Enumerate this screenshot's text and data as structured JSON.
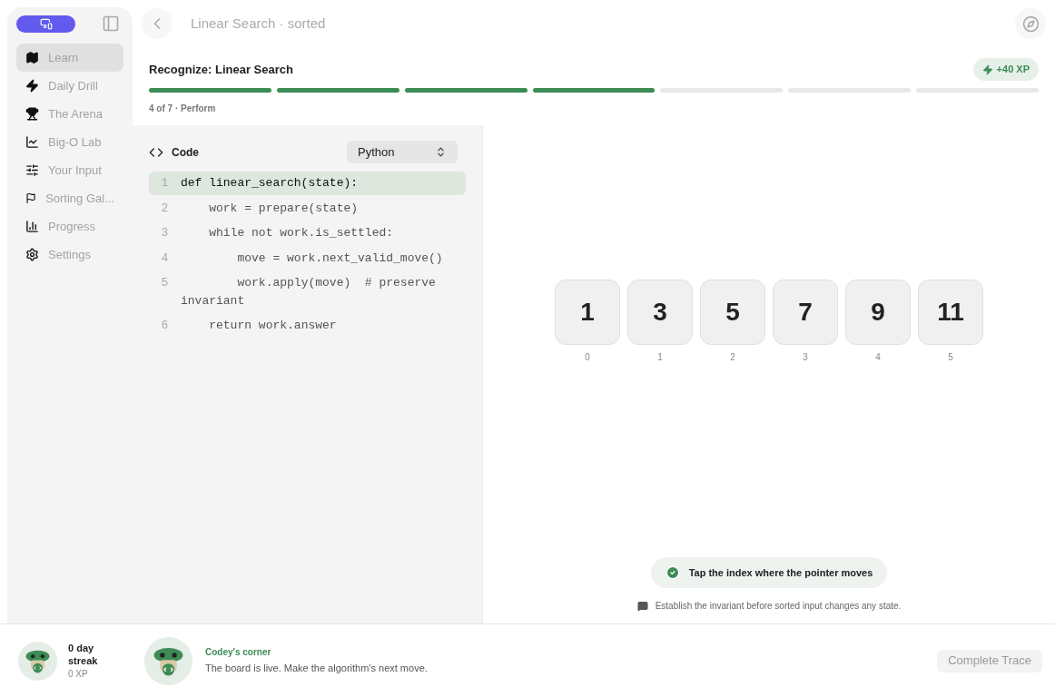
{
  "sidebar": {
    "items": [
      {
        "label": "Learn",
        "selected": true
      },
      {
        "label": "Daily Drill",
        "selected": false
      },
      {
        "label": "The Arena",
        "selected": false
      },
      {
        "label": "Big-O Lab",
        "selected": false
      },
      {
        "label": "Your Input",
        "selected": false
      },
      {
        "label": "Sorting Gal...",
        "selected": false
      },
      {
        "label": "Progress",
        "selected": false
      },
      {
        "label": "Settings",
        "selected": false
      }
    ],
    "streak": {
      "title": "0 day streak",
      "xp": "0 XP"
    }
  },
  "header": {
    "title": "Linear Search · sorted"
  },
  "lesson": {
    "title": "Recognize: Linear Search",
    "xp_badge": "+40 XP",
    "step_label": "4 of 7 · Perform",
    "steps": [
      {
        "done": true
      },
      {
        "done": true
      },
      {
        "done": true
      },
      {
        "done": true
      },
      {
        "done": false
      },
      {
        "done": false
      },
      {
        "done": false
      }
    ]
  },
  "code": {
    "heading": "Code",
    "language": "Python",
    "lines": [
      {
        "number": "1",
        "text": "def linear_search(state):",
        "selected": true
      },
      {
        "number": "2",
        "text": "    work = prepare(state)",
        "selected": false
      },
      {
        "number": "3",
        "text": "    while not work.is_settled:",
        "selected": false
      },
      {
        "number": "4",
        "text": "        move = work.next_valid_move()",
        "selected": false
      },
      {
        "number": "5",
        "text": "        work.apply(move)  # preserve invariant",
        "selected": false
      },
      {
        "number": "6",
        "text": "    return work.answer",
        "selected": false
      }
    ]
  },
  "array": [
    {
      "value": "1",
      "index": "0"
    },
    {
      "value": "3",
      "index": "1"
    },
    {
      "value": "5",
      "index": "2"
    },
    {
      "value": "7",
      "index": "3"
    },
    {
      "value": "9",
      "index": "4"
    },
    {
      "value": "11",
      "index": "5"
    }
  ],
  "prompt": {
    "text": "Tap the index where the pointer moves",
    "hint": "Establish the invariant before sorted input changes any state."
  },
  "footer": {
    "title": "Codey's corner",
    "message": "The board is live. Make the algorithm's next move.",
    "button": "Complete Trace",
    "button_disabled": true
  }
}
